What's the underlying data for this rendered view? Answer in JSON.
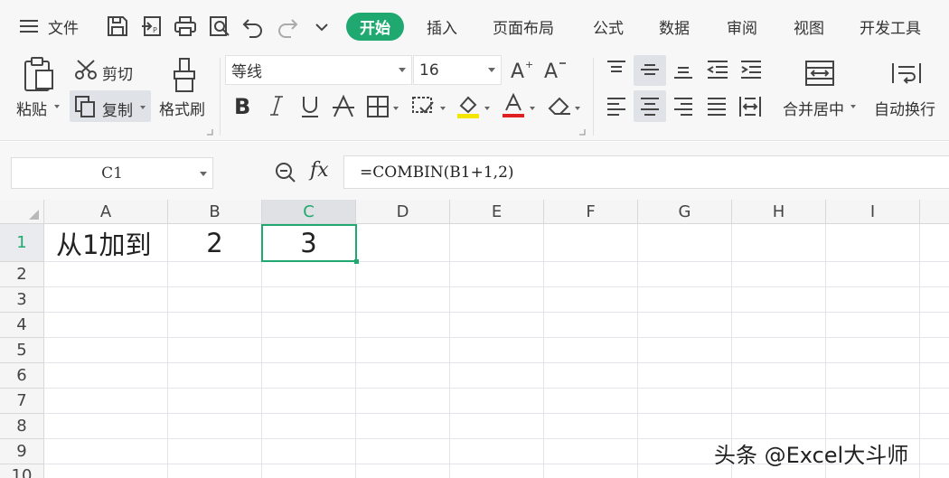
{
  "menubar": {
    "menu_label": "文件",
    "tabs": [
      {
        "label": "开始",
        "active": true
      },
      {
        "label": "插入"
      },
      {
        "label": "页面布局"
      },
      {
        "label": "公式"
      },
      {
        "label": "数据"
      },
      {
        "label": "审阅"
      },
      {
        "label": "视图"
      },
      {
        "label": "开发工具"
      }
    ]
  },
  "ribbon": {
    "paste": "粘贴",
    "cut": "剪切",
    "copy": "复制",
    "format_painter": "格式刷",
    "font_name": "等线",
    "font_size": "16",
    "merge_center": "合并居中",
    "wrap_text": "自动换行"
  },
  "formula_bar": {
    "name_box": "C1",
    "fx_label": "fx",
    "formula": "=COMBIN(B1+1,2)"
  },
  "sheet": {
    "columns": [
      "A",
      "B",
      "C",
      "D",
      "E",
      "F",
      "G",
      "H",
      "I"
    ],
    "rows": [
      "1",
      "2",
      "3",
      "4",
      "5",
      "6",
      "7",
      "8",
      "9",
      "10"
    ],
    "selected_cell": "C1",
    "cells": {
      "A1": "从1加到",
      "B1": "2",
      "C1": "3"
    }
  },
  "watermark": "头条 @Excel大斗师",
  "colors": {
    "accent": "#1fa971",
    "font_color_bar": "#e02020",
    "highlight_bar": "#f5e600"
  }
}
